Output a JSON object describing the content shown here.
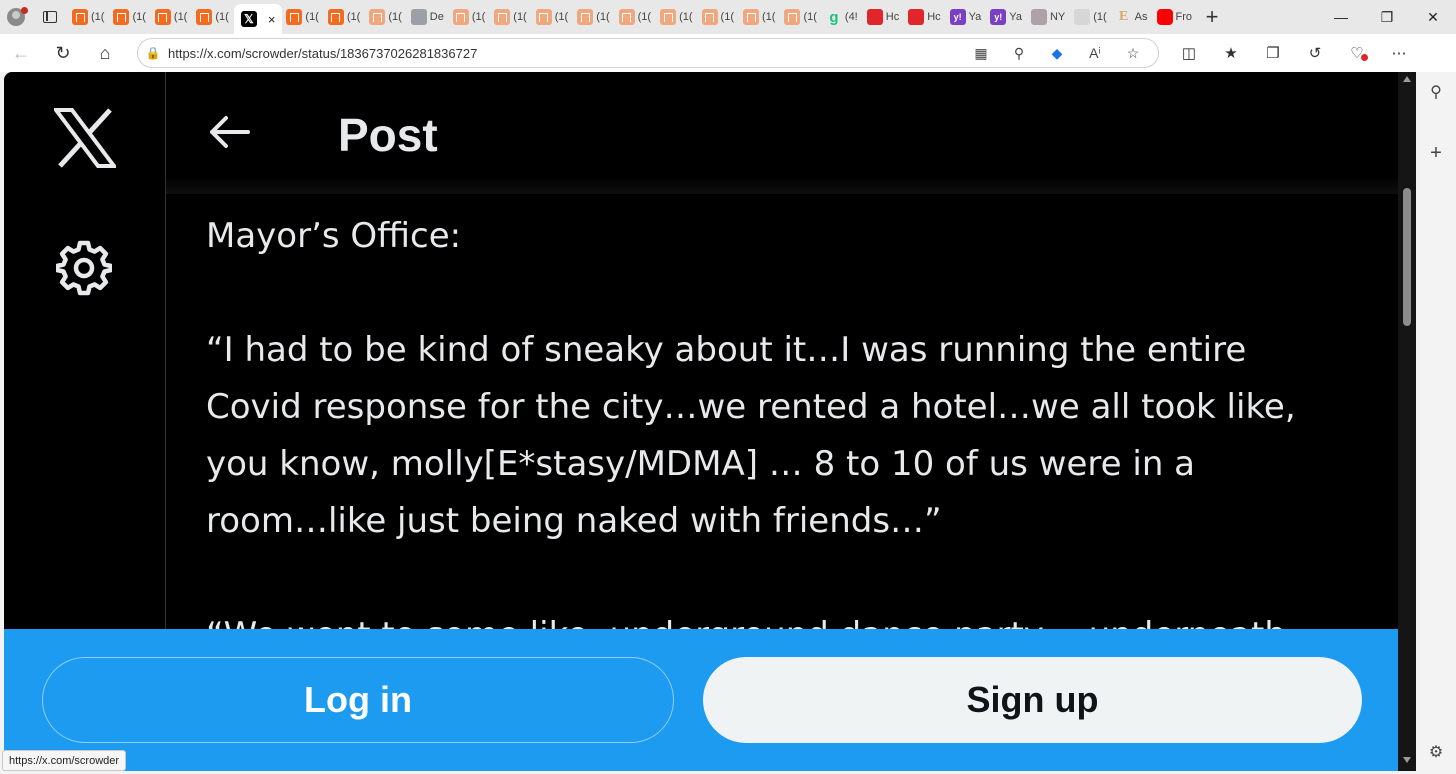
{
  "browser": {
    "tabs": [
      {
        "icon": "orange-bookmark",
        "label": "(1("
      },
      {
        "icon": "orange-bookmark",
        "label": "(1("
      },
      {
        "icon": "orange-bookmark",
        "label": "(1("
      },
      {
        "icon": "orange-bookmark",
        "label": "(1("
      },
      {
        "icon": "x-logo",
        "label": "",
        "active": true
      },
      {
        "icon": "orange-bookmark",
        "label": "(1("
      },
      {
        "icon": "orange-bookmark",
        "label": "(1("
      },
      {
        "icon": "light-bookmark",
        "label": "(1("
      },
      {
        "icon": "gray-play",
        "label": "De"
      },
      {
        "icon": "light-bookmark",
        "label": "(1("
      },
      {
        "icon": "light-bookmark",
        "label": "(1("
      },
      {
        "icon": "light-bookmark",
        "label": "(1("
      },
      {
        "icon": "light-bookmark",
        "label": "(1("
      },
      {
        "icon": "light-bookmark",
        "label": "(1("
      },
      {
        "icon": "light-bookmark",
        "label": "(1("
      },
      {
        "icon": "light-bookmark",
        "label": "(1("
      },
      {
        "icon": "light-bookmark",
        "label": "(1("
      },
      {
        "icon": "light-bookmark",
        "label": "(1("
      },
      {
        "icon": "green-g",
        "label": "(4!"
      },
      {
        "icon": "red-badge",
        "label": "Hc"
      },
      {
        "icon": "pink-badge",
        "label": "Hc"
      },
      {
        "icon": "yahoo",
        "label": "Ya"
      },
      {
        "icon": "yahoo",
        "label": "Ya"
      },
      {
        "icon": "nytimes",
        "label": "NY"
      },
      {
        "icon": "light-page",
        "label": "(1("
      },
      {
        "icon": "e-letter",
        "label": "As"
      },
      {
        "icon": "youtube",
        "label": "Fro"
      }
    ],
    "fav_glyphs": {
      "x": "𝕏",
      "g": "g",
      "e": "E",
      "y": "y!"
    },
    "tab_close": "×",
    "new_tab": "+",
    "window_controls": {
      "minimize": "—",
      "maximize": "❐",
      "close": "✕"
    },
    "url": "https://x.com/scrowder/status/1836737026281836727",
    "status_link": "https://x.com/scrowder"
  },
  "page": {
    "header_title": "Post",
    "paragraphs": [
      "Mayor’s Office:",
      "“I had to be kind of sneaky about it…I was running the entire\nCovid response for the city…we rented a hotel…we all took like,\nyou know, molly[E*stasy/MDMA] … 8 to 10 of us were in a\nroom…like just being naked with friends…”",
      "“We went to some like, underground dance party… underneath"
    ],
    "login_label": "Log in",
    "signup_label": "Sign up"
  },
  "colors": {
    "accent": "#1d9bf0",
    "page_bg": "#000000",
    "text": "#e7e9ea",
    "signup_bg": "#eff3f4"
  }
}
